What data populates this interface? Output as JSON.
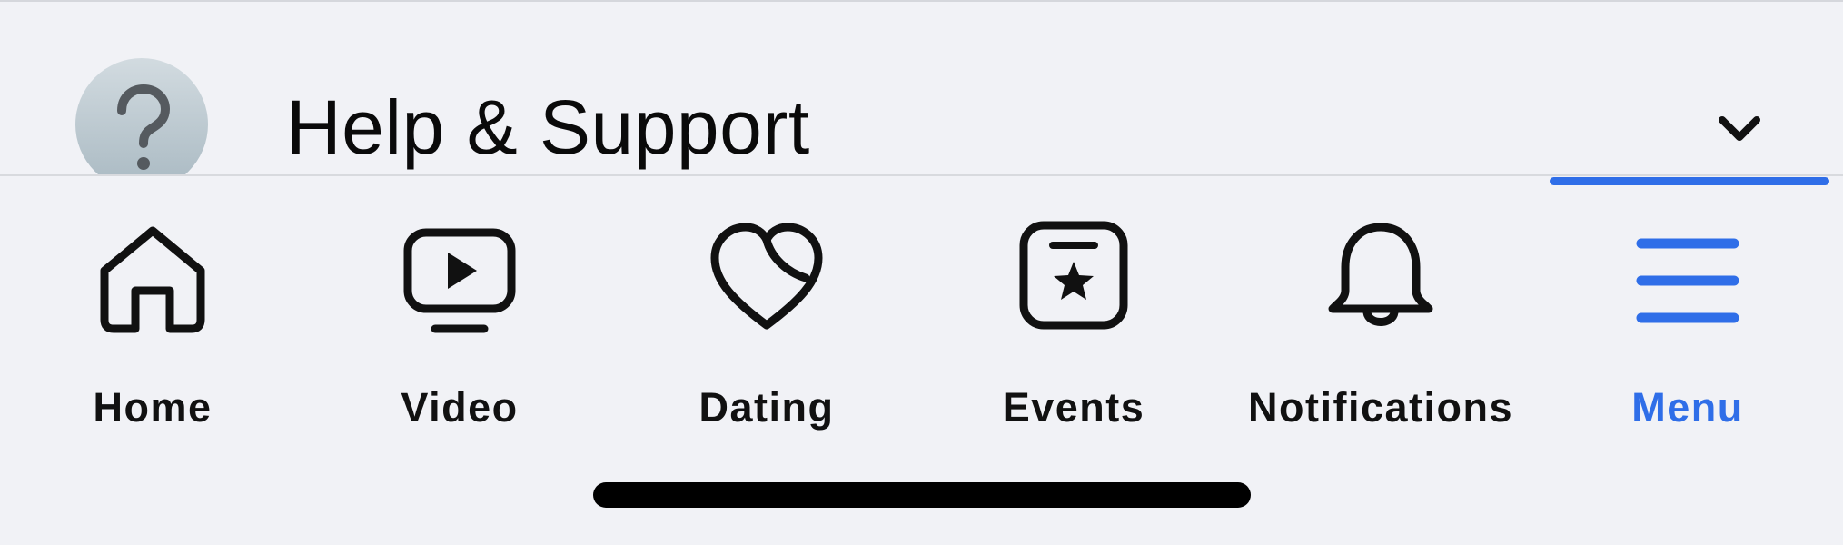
{
  "help_section": {
    "title": "Help & Support",
    "icon": "question-mark-icon",
    "expand_icon": "chevron-down-icon"
  },
  "tabbar": {
    "accent_color": "#2f6ee8",
    "active_tab": "Menu",
    "tabs": [
      {
        "label": "Home",
        "icon": "home-icon"
      },
      {
        "label": "Video",
        "icon": "video-icon"
      },
      {
        "label": "Dating",
        "icon": "dating-heart-icon"
      },
      {
        "label": "Events",
        "icon": "events-star-icon"
      },
      {
        "label": "Notifications",
        "icon": "bell-icon"
      },
      {
        "label": "Menu",
        "icon": "hamburger-menu-icon"
      }
    ]
  }
}
